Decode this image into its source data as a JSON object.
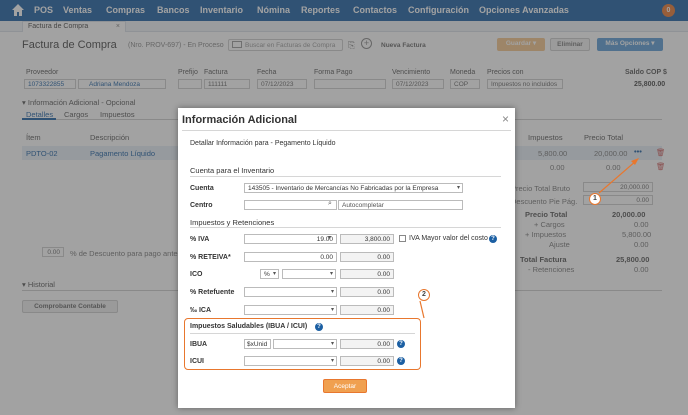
{
  "nav": {
    "items": [
      "POS",
      "Ventas",
      "Compras",
      "Bancos",
      "Inventario",
      "Nómina",
      "Reportes",
      "Contactos",
      "Configuración",
      "Opciones Avanzadas"
    ],
    "badge": "0"
  },
  "tab": {
    "label": "Factura de Compra",
    "close": "×"
  },
  "header": {
    "title": "Factura de Compra",
    "subtitle": "(Nro. PROV-697) - En Proceso",
    "search_placeholder": "Buscar en Facturas de Compra",
    "new_invoice": "Nueva Factura",
    "save": "Guardar",
    "delete": "Eliminar",
    "more": "Más Opciones"
  },
  "form": {
    "proveedor_label": "Proveedor",
    "proveedor_id": "1073322855",
    "proveedor_name": "Adriana Mendoza",
    "prefijo_label": "Prefijo",
    "factura_label": "Factura",
    "factura_value": "111111",
    "fecha_label": "Fecha",
    "fecha_value": "07/12/2023",
    "forma_pago_label": "Forma Pago",
    "vencimiento_label": "Vencimiento",
    "vencimiento_value": "07/12/2023",
    "moneda_label": "Moneda",
    "moneda_value": "COP",
    "precios_label": "Precios con",
    "precios_value": "Impuestos no incluidos",
    "saldo_label": "Saldo COP $",
    "saldo_value": "25,800.00"
  },
  "section": {
    "info_adicional": "Información Adicional - Opcional",
    "tabs": [
      "Detalles",
      "Cargos",
      "Impuestos"
    ],
    "col_item": "Ítem",
    "col_desc": "Descripción",
    "col_impuestos": "Impuestos",
    "col_precio_total": "Precio Total",
    "row_item": "PDTO-02",
    "row_desc": "Pagamento Líquido",
    "row_impuestos": "5,800.00",
    "row_precio": "20,000.00",
    "row2_impuestos": "0.00",
    "row2_precio": "0.00",
    "descuento_value": "0.00",
    "descuento_label": "% de Descuento para pago antes de",
    "historial": "Historial",
    "comprobante": "Comprobante Contable"
  },
  "totals": {
    "precio_total_bruto_label": "Precio Total Bruto",
    "precio_total_bruto": "20,000.00",
    "descuento_pie_label": "Descuento Pie Pág.",
    "descuento_pie": "0.00",
    "precio_total_label": "Precio Total",
    "precio_total": "20,000.00",
    "cargos_label": "+ Cargos",
    "cargos": "0.00",
    "impuestos_label": "+ Impuestos",
    "impuestos": "5,800.00",
    "ajuste_label": "Ajuste",
    "ajuste": "0.00",
    "total_factura_label": "Total Factura",
    "total_factura": "25,800.00",
    "retenciones_label": "- Retenciones",
    "retenciones": "0.00"
  },
  "modal": {
    "title": "Información Adicional",
    "close": "×",
    "subtitle": "Detallar Información para - Pegamento Líquido",
    "cuenta_inventario": "Cuenta para el Inventario",
    "cuenta_label": "Cuenta",
    "cuenta_value": "143505 - Inventario de Mercancías No Fabricadas por la Empresa",
    "centro_label": "Centro",
    "centro_placeholder": "Autocompletar",
    "impuestos_retenciones": "Impuestos y Retenciones",
    "iva_label": "% IVA",
    "iva_pct": "19.00",
    "iva_value": "3,800.00",
    "iva_mayor": "IVA Mayor valor del costo",
    "reteiva_label": "% RETEIVA*",
    "reteiva_pct": "0.00",
    "reteiva_value": "0.00",
    "ico_label": "ICO",
    "ico_unit": "%",
    "ico_value": "0.00",
    "retefuente_label": "% Retefuente",
    "retefuente_value": "0.00",
    "ica_label": "‰ ICA",
    "ica_value": "0.00",
    "saludables_title": "Impuestos Saludables (IBUA / ICUI)",
    "ibua_label": "IBUA",
    "ibua_unit": "$xUnid",
    "ibua_value": "0.00",
    "icui_label": "ICUI",
    "icui_value": "0.00",
    "accept": "Aceptar"
  },
  "callouts": [
    "1",
    "2"
  ],
  "colors": {
    "nav": "#1b5fa3",
    "accent": "#e8772e",
    "link": "#1b5fa3"
  }
}
